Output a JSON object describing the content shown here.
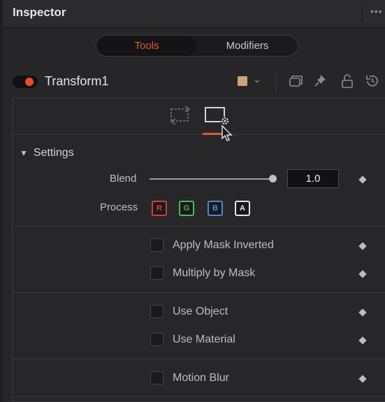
{
  "window": {
    "title": "Inspector",
    "menu_glyph": "•••"
  },
  "tabs": [
    {
      "label": "Tools",
      "active": true
    },
    {
      "label": "Modifiers",
      "active": false
    }
  ],
  "tool": {
    "name": "Transform1",
    "enabled": true,
    "color_swatch": "#c9a47a",
    "chevron": "⌄",
    "actions": [
      "duplicate-icon",
      "pin-icon",
      "lock-icon",
      "reset-icon"
    ]
  },
  "icon_tabs": [
    "transform-controls-icon",
    "settings-icon"
  ],
  "settings": {
    "section_label": "Settings",
    "blend": {
      "label": "Blend",
      "value": "1.0",
      "level": 1.0
    },
    "process": {
      "label": "Process",
      "channels": [
        {
          "label": "R",
          "color": "#d93b3b"
        },
        {
          "label": "G",
          "color": "#3fbf4a"
        },
        {
          "label": "B",
          "color": "#4a8ad6"
        },
        {
          "label": "A",
          "color": "#e6e6e6"
        }
      ]
    },
    "checkboxes": [
      {
        "label": "Apply Mask Inverted"
      },
      {
        "label": "Multiply by Mask"
      },
      {
        "label": "Use Object"
      },
      {
        "label": "Use Material"
      },
      {
        "label": "Motion Blur"
      }
    ]
  },
  "colors": {
    "accent": "#e0553a",
    "toggle_on": "#ec4a2a",
    "panel_bg": "#262628"
  }
}
